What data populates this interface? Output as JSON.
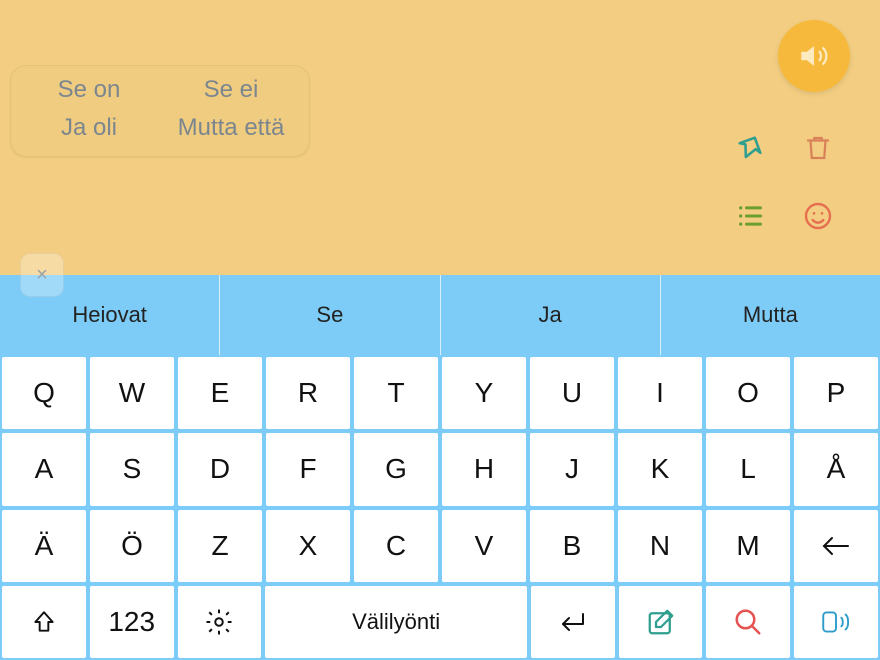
{
  "phrases": {
    "tl": "Se on",
    "tr": "Se ei",
    "bl": "Ja oli",
    "br": "Mutta että"
  },
  "predictions": [
    "Heiovat",
    "Se",
    "Ja",
    "Mutta"
  ],
  "keys": {
    "row1": [
      "Q",
      "W",
      "E",
      "R",
      "T",
      "Y",
      "U",
      "I",
      "O",
      "P"
    ],
    "row2": [
      "A",
      "S",
      "D",
      "F",
      "G",
      "H",
      "J",
      "K",
      "L",
      "Å"
    ],
    "row3": [
      "Ä",
      "Ö",
      "Z",
      "X",
      "C",
      "V",
      "B",
      "N",
      "M"
    ],
    "row4": {
      "numbers": "123",
      "space": "Välilyönti"
    }
  },
  "close_glyph": "×"
}
